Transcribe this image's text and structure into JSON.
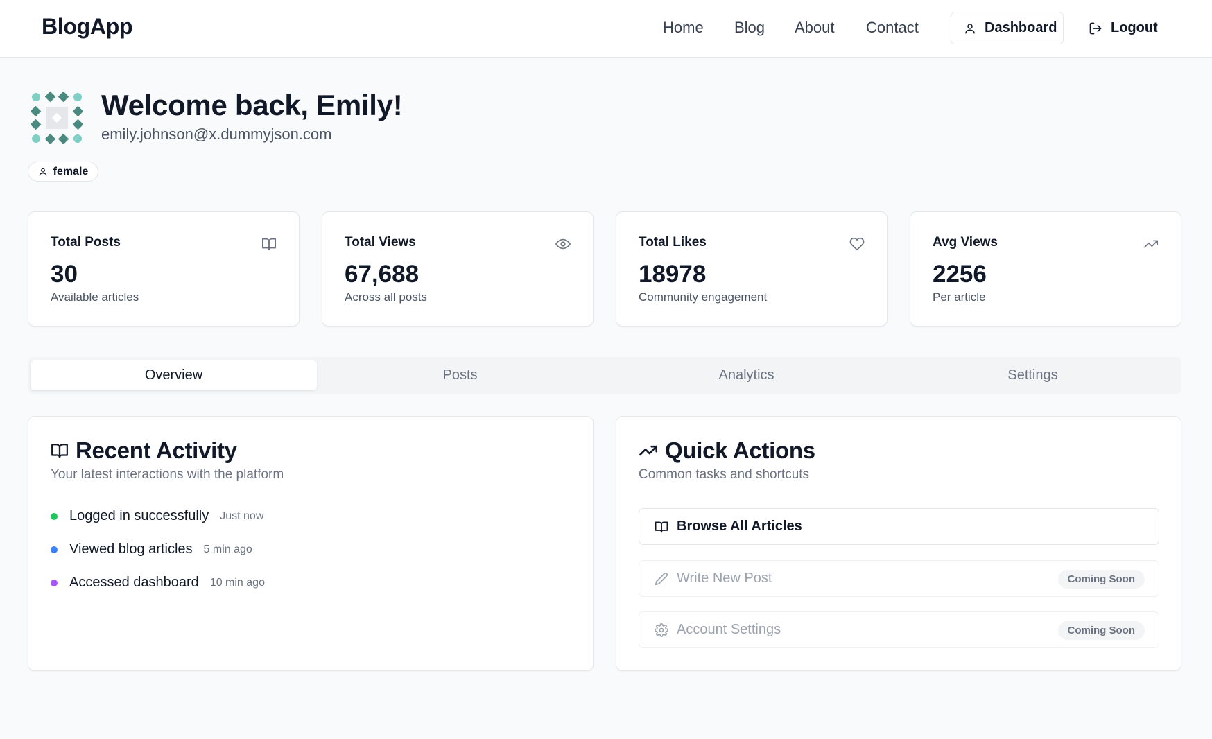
{
  "header": {
    "logo": "BlogApp",
    "nav": [
      "Home",
      "Blog",
      "About",
      "Contact"
    ],
    "dashboard_label": "Dashboard",
    "logout_label": "Logout"
  },
  "user": {
    "welcome": "Welcome back, Emily!",
    "email": "emily.johnson@x.dummyjson.com",
    "gender": "female"
  },
  "stats": [
    {
      "title": "Total Posts",
      "value": "30",
      "sub": "Available articles",
      "icon": "book-open-icon"
    },
    {
      "title": "Total Views",
      "value": "67,688",
      "sub": "Across all posts",
      "icon": "eye-icon"
    },
    {
      "title": "Total Likes",
      "value": "18978",
      "sub": "Community engagement",
      "icon": "heart-icon"
    },
    {
      "title": "Avg Views",
      "value": "2256",
      "sub": "Per article",
      "icon": "trending-up-icon"
    }
  ],
  "tabs": [
    "Overview",
    "Posts",
    "Analytics",
    "Settings"
  ],
  "active_tab": "Overview",
  "recent_activity": {
    "title": "Recent Activity",
    "subtitle": "Your latest interactions with the platform",
    "items": [
      {
        "label": "Logged in successfully",
        "time": "Just now",
        "color": "#22c55e"
      },
      {
        "label": "Viewed blog articles",
        "time": "5 min ago",
        "color": "#3b82f6"
      },
      {
        "label": "Accessed dashboard",
        "time": "10 min ago",
        "color": "#a855f7"
      }
    ]
  },
  "quick_actions": {
    "title": "Quick Actions",
    "subtitle": "Common tasks and shortcuts",
    "items": [
      {
        "label": "Browse All Articles",
        "icon": "book-open-icon",
        "badge": ""
      },
      {
        "label": "Write New Post",
        "icon": "pencil-icon",
        "badge": "Coming Soon"
      },
      {
        "label": "Account Settings",
        "icon": "gear-icon",
        "badge": "Coming Soon"
      }
    ]
  },
  "colors": {
    "avatar_primary": "#4b8a80",
    "avatar_secondary": "#7fcfc4",
    "avatar_center": "#e5e7eb"
  }
}
